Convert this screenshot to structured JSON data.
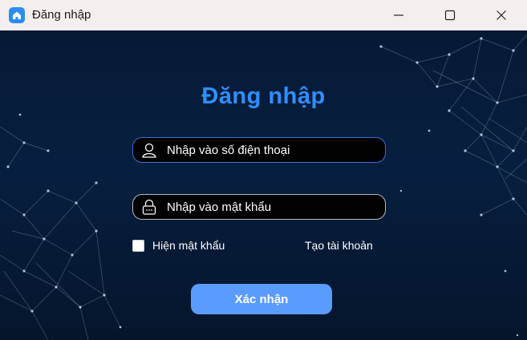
{
  "window": {
    "title": "Đăng nhập",
    "app_icon": "home-icon",
    "controls": [
      "minimize-icon",
      "maximize-icon",
      "close-icon"
    ]
  },
  "form": {
    "heading": "Đăng nhập",
    "phone": {
      "placeholder": "Nhập vào số điện thoại",
      "value": "",
      "icon": "user-icon"
    },
    "password": {
      "placeholder": "Nhập vào mật khẩu",
      "value": "",
      "icon": "lock-icon"
    },
    "show_password": {
      "label": "Hiện mật khẩu",
      "checked": false
    },
    "create_account": "Tạo tài khoản",
    "submit": "Xác nhận"
  },
  "colors": {
    "background": "#061a36",
    "heading": "#2f8fff",
    "button": "#5a9bff",
    "phone_border": "#3a6fd8"
  }
}
